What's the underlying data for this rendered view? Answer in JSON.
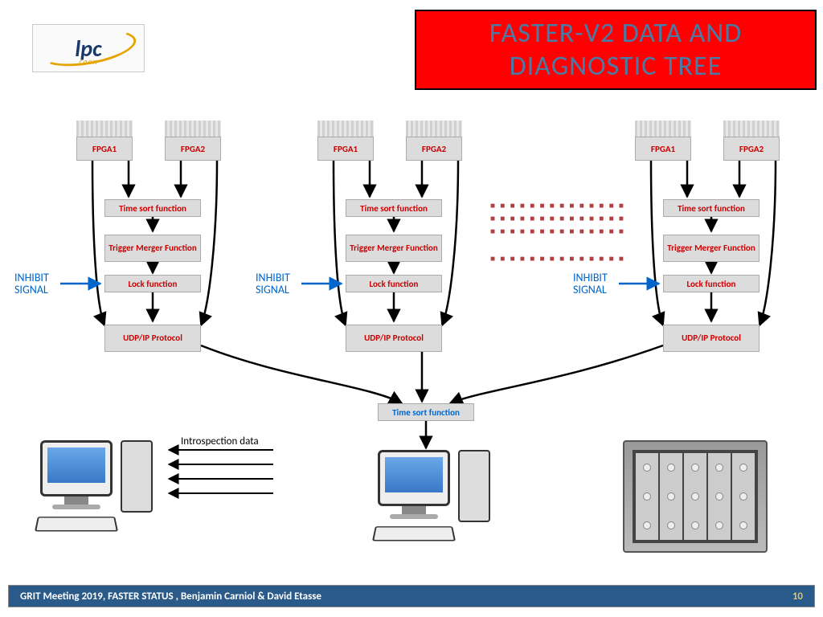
{
  "logo": {
    "main": "lpc",
    "sub": "caen"
  },
  "title": "FASTER-V2 DATA AND DIAGNOSTIC  TREE",
  "columns": [
    {
      "fpga1": "FPGA1",
      "fpga2": "FPGA2",
      "timesort": "Time sort function",
      "trigger": "Trigger Merger Function",
      "lock": "Lock function",
      "udp": "UDP/IP Protocol",
      "inhibit": "INHIBIT SIGNAL"
    },
    {
      "fpga1": "FPGA1",
      "fpga2": "FPGA2",
      "timesort": "Time sort function",
      "trigger": "Trigger Merger Function",
      "lock": "Lock function",
      "udp": "UDP/IP Protocol",
      "inhibit": "INHIBIT SIGNAL"
    },
    {
      "fpga1": "FPGA1",
      "fpga2": "FPGA2",
      "timesort": "Time sort function",
      "trigger": "Trigger Merger Function",
      "lock": "Lock function",
      "udp": "UDP/IP Protocol",
      "inhibit": "INHIBIT SIGNAL"
    }
  ],
  "central_sort": "Time sort function",
  "introspection": "Introspection data",
  "footer": {
    "text": "GRIT Meeting 2019, FASTER STATUS , Benjamin Carniol & David Etasse",
    "page": "10"
  },
  "colors": {
    "title_bg": "#ff0000",
    "title_fg": "#4a7aa6",
    "box_fg": "#cc0000",
    "blue": "#0066cc",
    "footer_bg": "#2a5a8a"
  }
}
